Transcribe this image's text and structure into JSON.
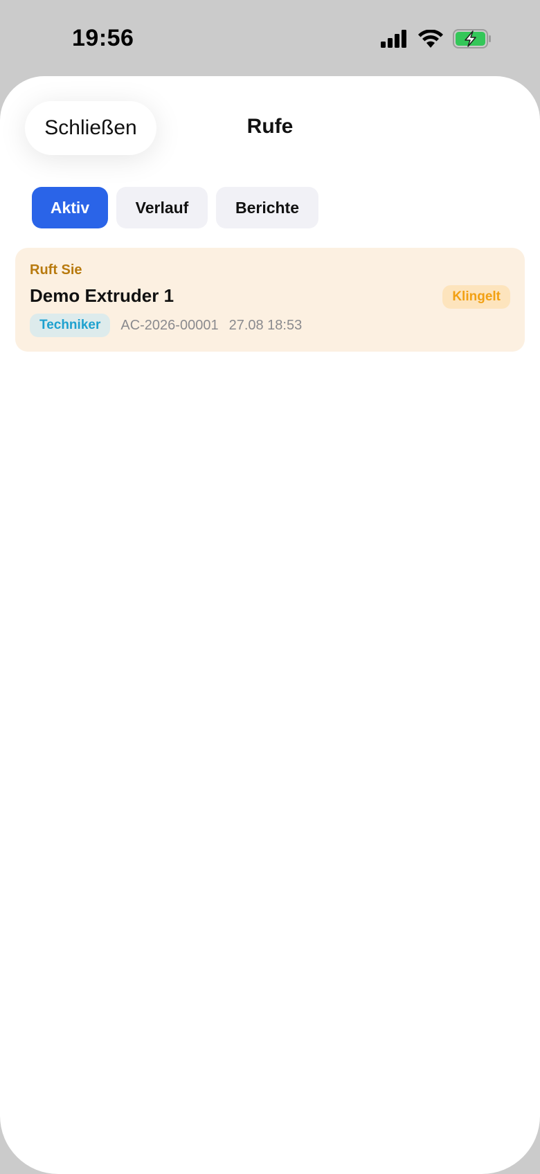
{
  "status_bar": {
    "time": "19:56",
    "icons": [
      "cellular-signal-icon",
      "wifi-icon",
      "battery-charging-icon"
    ]
  },
  "sheet": {
    "close_label": "Schließen",
    "title": "Rufe"
  },
  "tabs": [
    {
      "label": "Aktiv",
      "active": true
    },
    {
      "label": "Verlauf",
      "active": false
    },
    {
      "label": "Berichte",
      "active": false
    }
  ],
  "calls": [
    {
      "direction": "Ruft Sie",
      "name": "Demo Extruder 1",
      "status": "Klingelt",
      "role": "Techniker",
      "id": "AC-2026-00001",
      "timestamp": "27.08 18:53"
    }
  ],
  "colors": {
    "accent": "#2a64e8",
    "card_background": "#fcf0e1",
    "direction_text": "#b87a0e",
    "status_text": "#f2a012",
    "role_text": "#1ea1cf",
    "battery_fill": "#34c759"
  }
}
